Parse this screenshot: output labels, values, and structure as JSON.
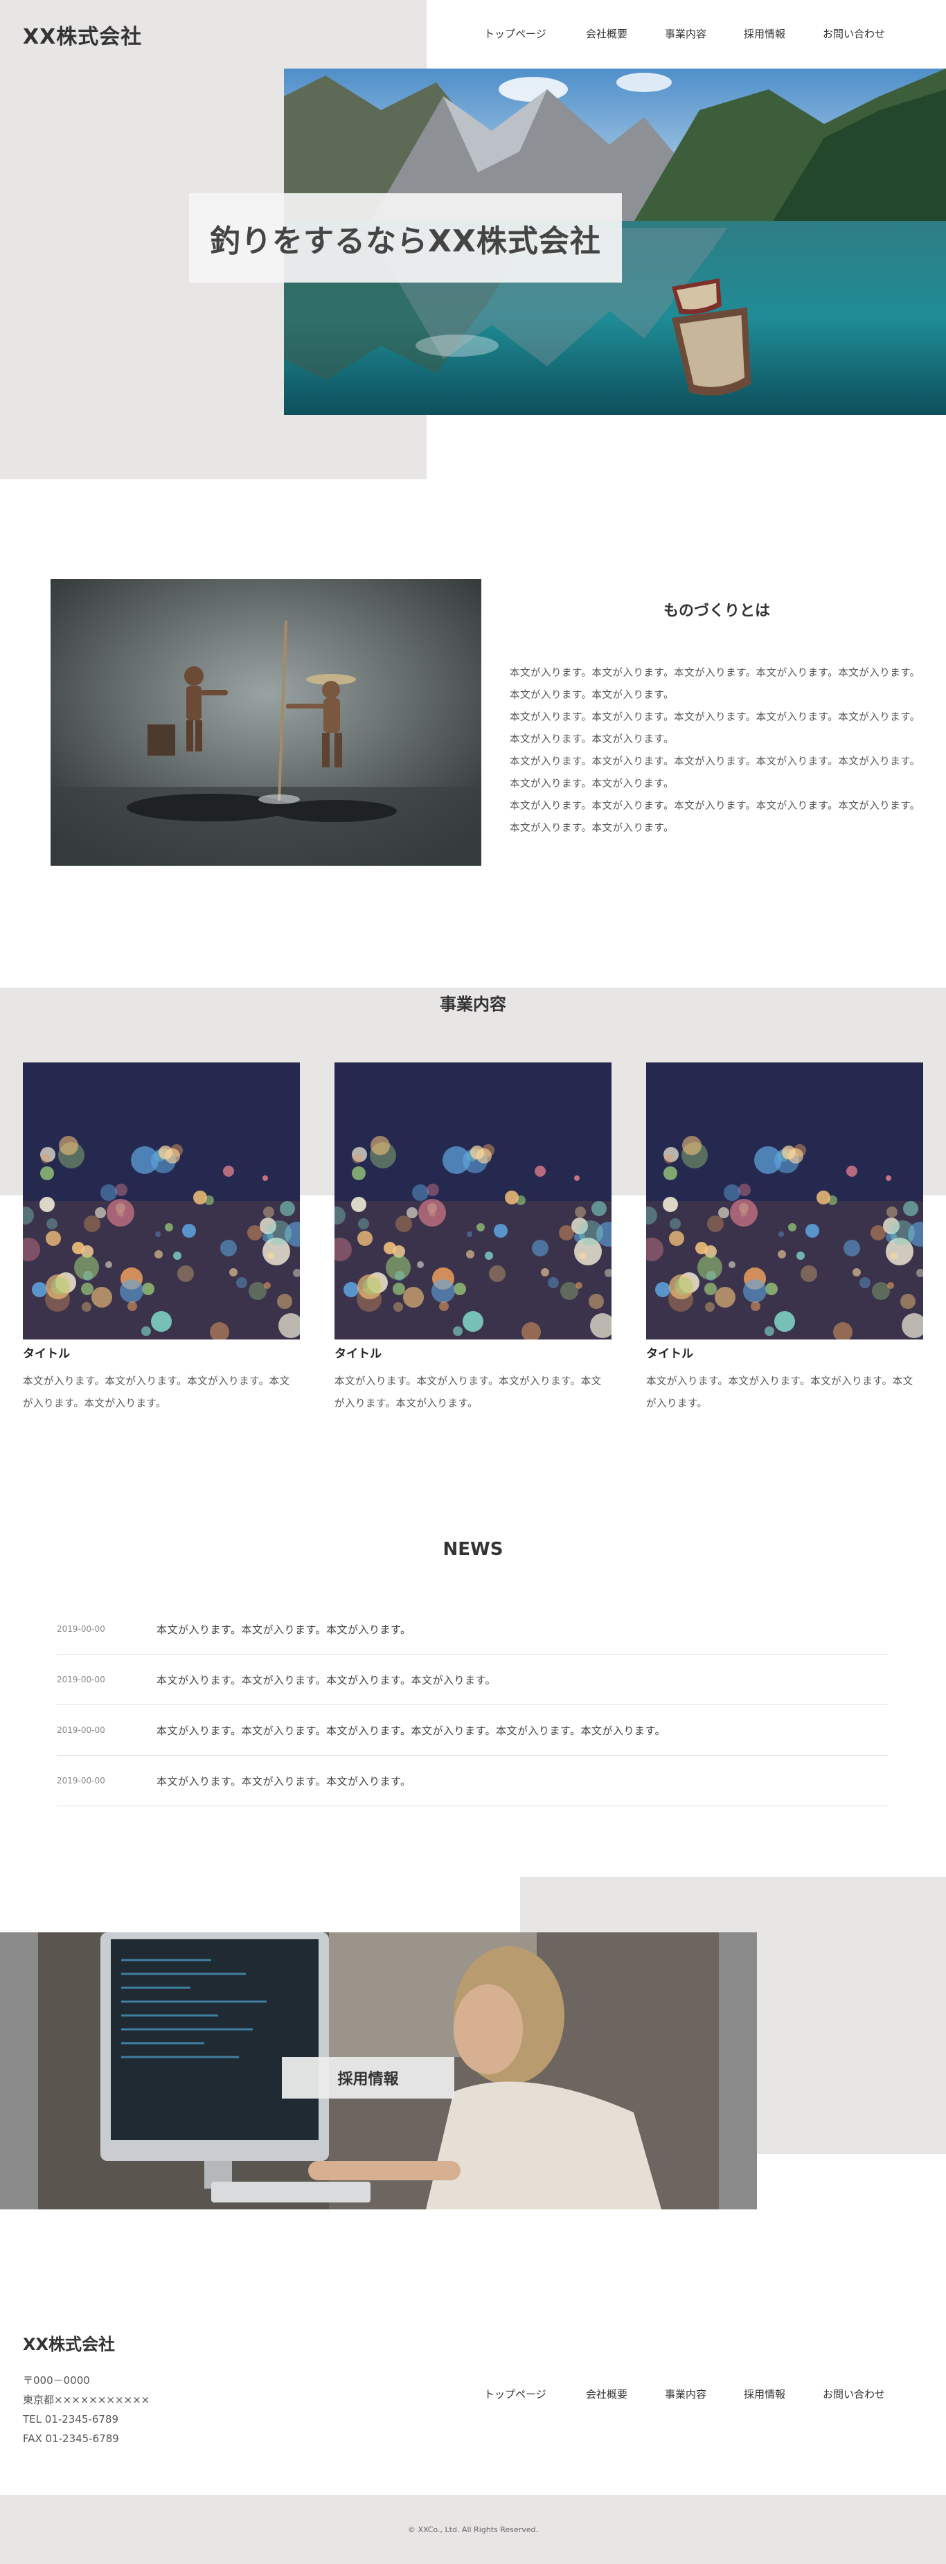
{
  "header": {
    "logo": "XX株式会社",
    "nav": [
      "トップページ",
      "会社概要",
      "事業内容",
      "採用情報",
      "お問い合わせ"
    ]
  },
  "hero": {
    "catch": "釣りをするならXX株式会社"
  },
  "about": {
    "title": "ものづくりとは",
    "paragraphs": [
      "本文が入ります。本文が入ります。本文が入ります。本文が入ります。本文が入ります。本文が入ります。本文が入ります。",
      "本文が入ります。本文が入ります。本文が入ります。本文が入ります。本文が入ります。本文が入ります。本文が入ります。",
      "本文が入ります。本文が入ります。本文が入ります。本文が入ります。本文が入ります。本文が入ります。本文が入ります。",
      "本文が入ります。本文が入ります。本文が入ります。本文が入ります。本文が入ります。本文が入ります。本文が入ります。"
    ]
  },
  "business": {
    "title": "事業内容",
    "cards": [
      {
        "title": "タイトル",
        "text": "本文が入ります。本文が入ります。本文が入ります。本文が入ります。本文が入ります。"
      },
      {
        "title": "タイトル",
        "text": "本文が入ります。本文が入ります。本文が入ります。本文が入ります。本文が入ります。"
      },
      {
        "title": "タイトル",
        "text": "本文が入ります。本文が入ります。本文が入ります。本文が入ります。"
      }
    ]
  },
  "news": {
    "title": "NEWS",
    "items": [
      {
        "date": "2019-00-00",
        "text": "本文が入ります。本文が入ります。本文が入ります。"
      },
      {
        "date": "2019-00-00",
        "text": "本文が入ります。本文が入ります。本文が入ります。本文が入ります。"
      },
      {
        "date": "2019-00-00",
        "text": "本文が入ります。本文が入ります。本文が入ります。本文が入ります。本文が入ります。本文が入ります。"
      },
      {
        "date": "2019-00-00",
        "text": "本文が入ります。本文が入ります。本文が入ります。"
      }
    ]
  },
  "recruit": {
    "button": "採用情報"
  },
  "footer": {
    "logo": "XX株式会社",
    "address": [
      "〒000－0000",
      "東京都×××××××××××",
      "TEL 01-2345-6789",
      "FAX 01-2345-6789"
    ],
    "nav": [
      "トップページ",
      "会社概要",
      "事業内容",
      "採用情報",
      "お問い合わせ"
    ],
    "copyright": "© XXCo., Ltd. All Rights Reserved."
  },
  "colors": {
    "panel_gray": "#e8e5e5",
    "text": "#333333",
    "frame_gray": "#8a8a8a"
  }
}
